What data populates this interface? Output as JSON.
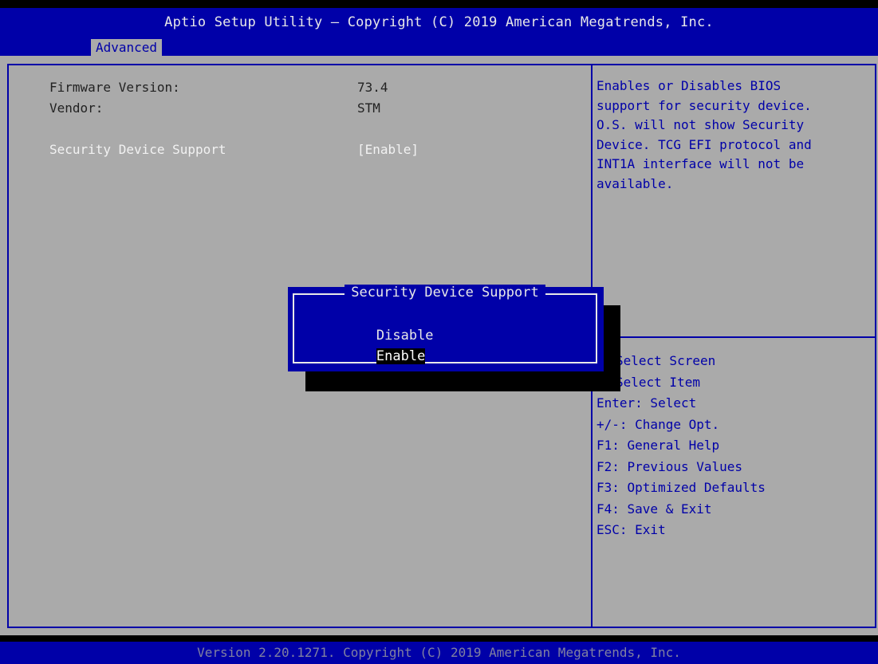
{
  "header": {
    "title": "Aptio Setup Utility – Copyright (C) 2019 American Megatrends, Inc.",
    "tabs": [
      "Advanced"
    ]
  },
  "settings": [
    {
      "label": "Firmware Version:",
      "value": "73.4"
    },
    {
      "label": "Vendor:",
      "value": "STM"
    },
    {
      "label": "Security Device Support",
      "value": "[Enable]"
    }
  ],
  "help_text": [
    "Enables or Disables BIOS",
    "support for security device.",
    "O.S. will not show Security",
    "Device. TCG EFI protocol and",
    "INT1A interface will not be",
    "available."
  ],
  "key_help": [
    "Select Screen",
    "Select Item",
    "Enter: Select",
    "+/-: Change Opt.",
    "F1: General Help",
    "F2: Previous Values",
    "F3: Optimized Defaults",
    "F4: Save & Exit",
    "ESC: Exit"
  ],
  "popup": {
    "title": "Security Device Support",
    "options": [
      "Disable",
      "Enable"
    ],
    "selected": "Enable"
  },
  "footer": "Version 2.20.1271. Copyright (C) 2019 American Megatrends, Inc.",
  "colors": {
    "bios_blue": "#0000a8",
    "panel_gray": "#aaaaaa",
    "text_white": "#e8e8e8",
    "highlight_black": "#000000"
  }
}
